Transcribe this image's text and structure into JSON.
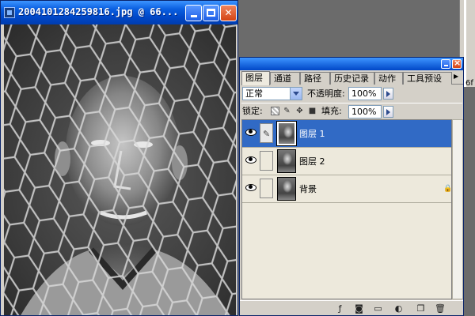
{
  "document": {
    "title": "2004101284259816.jpg @ 66...",
    "controls": {
      "minimize": "minimize",
      "maximize": "maximize",
      "close": "close"
    }
  },
  "side_panel": {
    "visible_text": "6f"
  },
  "layers_palette": {
    "tabs": [
      "图层",
      "通道",
      "路径",
      "历史记录",
      "动作",
      "工具预设"
    ],
    "active_tab": "图层",
    "blend_mode": "正常",
    "opacity_label": "不透明度:",
    "opacity_value": "100%",
    "lock_label": "锁定:",
    "fill_label": "填充:",
    "fill_value": "100%",
    "layers": [
      {
        "name": "图层 1",
        "visible": true,
        "selected": true,
        "locked": false
      },
      {
        "name": "图层 2",
        "visible": true,
        "selected": false,
        "locked": false
      },
      {
        "name": "背景",
        "visible": true,
        "selected": false,
        "locked": true
      }
    ],
    "bottom_icons": [
      "add-layer-style-icon",
      "add-mask-icon",
      "new-set-icon",
      "new-adjustment-layer-icon",
      "new-layer-icon",
      "trash-icon"
    ]
  },
  "colors": {
    "titlebar": "#0047c7",
    "close_button": "#d44415",
    "selection": "#316ac5",
    "panel_bg": "#d4d0c8"
  }
}
